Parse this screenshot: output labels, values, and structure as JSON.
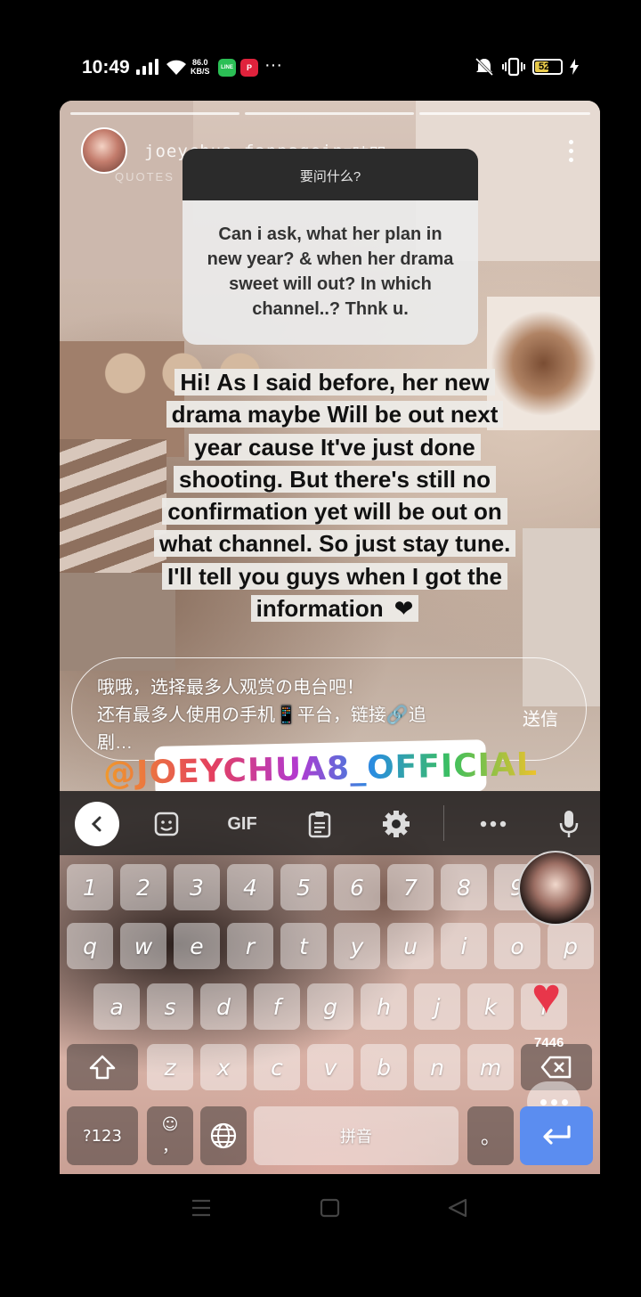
{
  "status_bar": {
    "time": "10:49",
    "net_speed": "86.0",
    "net_unit": "KB/S",
    "line_label": "LINE",
    "pinterest_label": "P",
    "more": "···",
    "battery": "52"
  },
  "story": {
    "username": "joeychua_fanpagein",
    "time_ago": "5時間",
    "sub_label": "QUOTES",
    "question_header": "要问什么?",
    "question_text": "Can i ask, what her plan in new year? & when her drama sweet will out? In which channel..? Thnk u.",
    "answer_text": "Hi! As I said before, her new drama maybe Will be out next year cause It've just done shooting. But there's still no confirmation yet will be out on what channel. So just stay tune. I'll tell you guys when I got the information",
    "answer_emoji": "❤",
    "mention": "@JOEYCHUA8_OFFICIAL"
  },
  "reply": {
    "text_line1": "哦哦，选择最多人观赏の电台吧！",
    "text_line2": "还有最多人使用の手机📱平台，链接🔗追",
    "text_line3": "剧…",
    "send_label": "送信"
  },
  "keyboard": {
    "gif_label": "GIF",
    "numbers": [
      "1",
      "2",
      "3",
      "4",
      "5",
      "6",
      "7",
      "8",
      "9",
      "0"
    ],
    "row1": [
      "q",
      "w",
      "e",
      "r",
      "t",
      "y",
      "u",
      "i",
      "o",
      "p"
    ],
    "row2": [
      "a",
      "s",
      "d",
      "f",
      "g",
      "h",
      "j",
      "k",
      "l"
    ],
    "row3": [
      "z",
      "x",
      "c",
      "v",
      "b",
      "n",
      "m"
    ],
    "symbols_label": "?123",
    "space_label": "拼音",
    "period_label": "。",
    "comma_label": "，",
    "like_count": "7446"
  },
  "colors": {
    "enter_key": "#5b8df0",
    "heart": "#e8364a",
    "question_header_bg": "#2b2b2b"
  }
}
